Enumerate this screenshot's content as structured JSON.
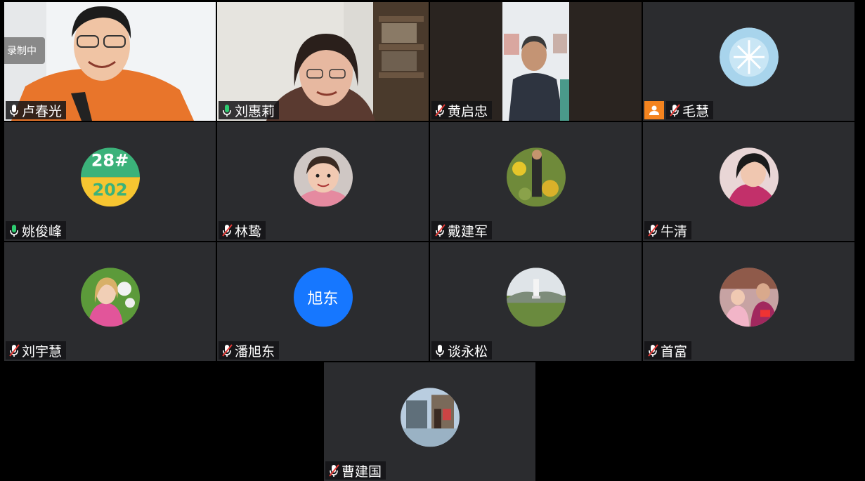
{
  "recording_label": "录制中",
  "participants": [
    {
      "name": "卢春光",
      "mic": "on"
    },
    {
      "name": "刘惠莉",
      "mic": "on"
    },
    {
      "name": "黄启忠",
      "mic": "muted"
    },
    {
      "name": "毛慧",
      "mic": "muted",
      "host_badge": "person-icon"
    },
    {
      "name": "姚俊峰",
      "mic": "on"
    },
    {
      "name": "林鸷",
      "mic": "muted"
    },
    {
      "name": "戴建军",
      "mic": "muted"
    },
    {
      "name": "牛清",
      "mic": "muted"
    },
    {
      "name": "刘宇慧",
      "mic": "muted"
    },
    {
      "name": "潘旭东",
      "mic": "muted",
      "initials": "旭东"
    },
    {
      "name": "谈永松",
      "mic": "idle"
    },
    {
      "name": "首富",
      "mic": "muted"
    },
    {
      "name": "曹建国",
      "mic": "muted"
    }
  ],
  "avatar_text": {
    "line1": "28#",
    "line2": "202"
  },
  "colors": {
    "tile_bg": "#2b2c2f",
    "mic_on": "#2ecc71",
    "mic_muted": "#e53935",
    "host_badge": "#f4841f",
    "initials_bg": "#1677ff"
  }
}
